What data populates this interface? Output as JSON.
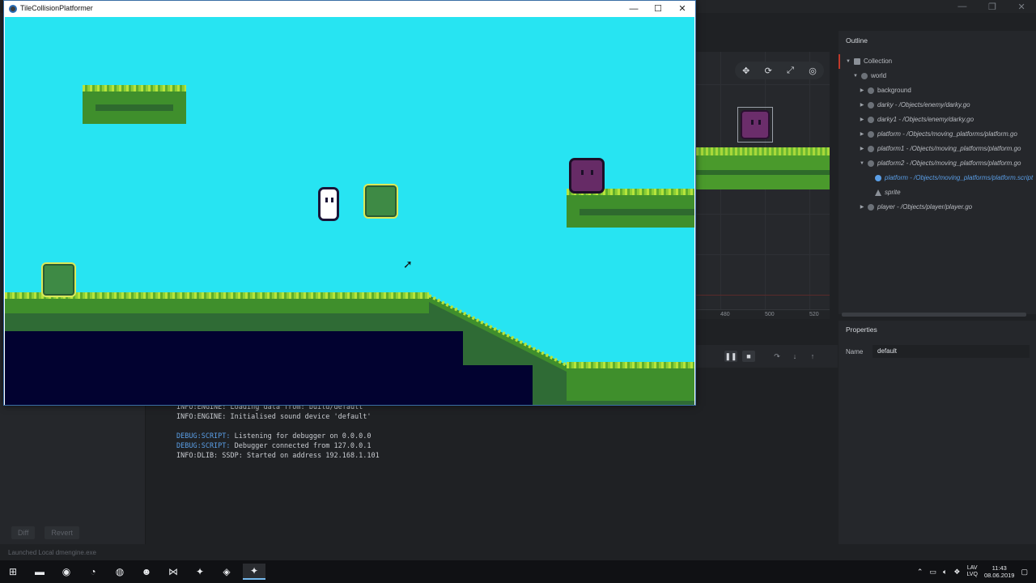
{
  "editor": {
    "minimize_glyph": "—",
    "restore_glyph": "❐",
    "close_glyph": "✕",
    "diff_label": "Diff",
    "revert_label": "Revert",
    "status": "Launched Local dmengine.exe"
  },
  "console": {
    "lines": [
      {
        "prefix": "INFO:ENGINE:",
        "text": " Loading data from: build/default"
      },
      {
        "prefix": "INFO:ENGINE:",
        "text": " Initialised sound device 'default'"
      },
      {
        "prefix": "DEBUG:SCRIPT:",
        "text": " Listening for debugger on 0.0.0.0"
      },
      {
        "prefix": "DEBUG:SCRIPT:",
        "text": " Debugger connected from 127.0.0.1"
      },
      {
        "prefix": "INFO:DLIB:",
        "text": " SSDP: Started on address 192.168.1.101"
      }
    ]
  },
  "scene": {
    "tools": [
      "move-icon",
      "rotate-icon",
      "scale-icon",
      "camera-icon"
    ],
    "ruler_labels": [
      "480",
      "500",
      "520"
    ]
  },
  "playback": {
    "pause_glyph": "❚❚",
    "stop_glyph": "■",
    "step_over_glyph": "↷",
    "step_into_glyph": "↓",
    "step_out_glyph": "↑"
  },
  "outline": {
    "title": "Outline",
    "items": [
      {
        "label": "Collection",
        "depth": 0,
        "expanded": true,
        "icon": "collection-icon",
        "italic": false
      },
      {
        "label": "world",
        "depth": 1,
        "expanded": true,
        "icon": "go-icon",
        "italic": false
      },
      {
        "label": "background",
        "depth": 2,
        "expanded": false,
        "icon": "go-icon",
        "italic": false
      },
      {
        "label": "darky - /Objects/enemy/darky.go",
        "depth": 2,
        "expanded": false,
        "icon": "go-icon",
        "italic": true
      },
      {
        "label": "darky1 - /Objects/enemy/darky.go",
        "depth": 2,
        "expanded": false,
        "icon": "go-icon",
        "italic": true
      },
      {
        "label": "platform - /Objects/moving_platforms/platform.go",
        "depth": 2,
        "expanded": false,
        "icon": "go-icon",
        "italic": true
      },
      {
        "label": "platform1 - /Objects/moving_platforms/platform.go",
        "depth": 2,
        "expanded": false,
        "icon": "go-icon",
        "italic": true
      },
      {
        "label": "platform2 - /Objects/moving_platforms/platform.go",
        "depth": 2,
        "expanded": true,
        "icon": "go-icon",
        "italic": true
      },
      {
        "label": "platform - /Objects/moving_platforms/platform.script",
        "depth": 3,
        "expanded": null,
        "icon": "script-icon",
        "italic": true,
        "selected": true
      },
      {
        "label": "sprite",
        "depth": 3,
        "expanded": null,
        "icon": "sprite-icon",
        "italic": true
      },
      {
        "label": "player - /Objects/player/player.go",
        "depth": 2,
        "expanded": false,
        "icon": "go-icon",
        "italic": true
      }
    ]
  },
  "properties": {
    "title": "Properties",
    "name_label": "Name",
    "name_value": "default"
  },
  "game_window": {
    "title": "TileCollisionPlatformer",
    "minimize_glyph": "—",
    "maximize_glyph": "☐",
    "close_glyph": "✕"
  },
  "taskbar": {
    "apps": [
      "windows-start-icon",
      "file-explorer-icon",
      "chrome-icon",
      "obs-icon",
      "tor-icon",
      "discord-icon",
      "vscode-icon",
      "defold-icon",
      "unity-icon",
      "defold-game-icon"
    ],
    "lang_top": "LAV",
    "lang_bottom": "LVQ",
    "time": "11:43",
    "date": "08.06.2019"
  }
}
